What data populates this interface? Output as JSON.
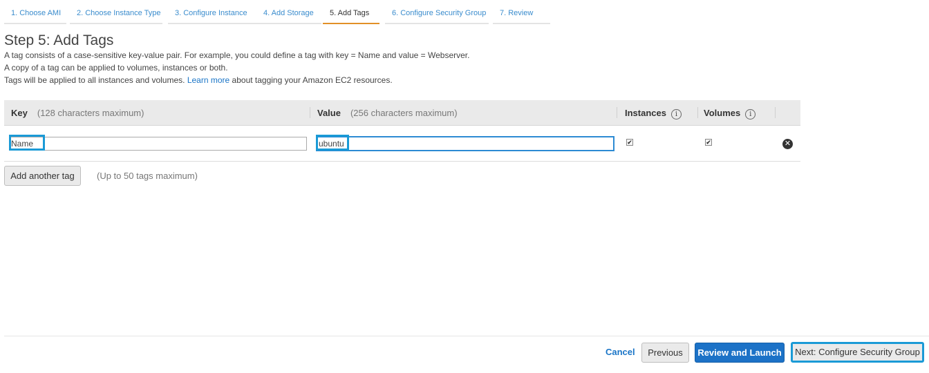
{
  "wizard": {
    "steps": [
      {
        "label": "1. Choose AMI"
      },
      {
        "label": "2. Choose Instance Type"
      },
      {
        "label": "3. Configure Instance"
      },
      {
        "label": "4. Add Storage"
      },
      {
        "label": "5. Add Tags",
        "active": true
      },
      {
        "label": "6. Configure Security Group"
      },
      {
        "label": "7. Review"
      }
    ]
  },
  "header": {
    "title": "Step 5: Add Tags",
    "line1": "A tag consists of a case-sensitive key-value pair. For example, you could define a tag with key = Name and value = Webserver.",
    "line2": "A copy of a tag can be applied to volumes, instances or both.",
    "line3_before": "Tags will be applied to all instances and volumes.",
    "learn_more": "Learn more",
    "line3_after": "about tagging your Amazon EC2 resources."
  },
  "table": {
    "columns": {
      "key": "Key",
      "key_hint": "(128 characters maximum)",
      "value": "Value",
      "value_hint": "(256 characters maximum)",
      "instances": "Instances",
      "volumes": "Volumes",
      "info_glyph": "i"
    },
    "rows": [
      {
        "key": "Name",
        "value": "ubuntu",
        "instances": true,
        "volumes": true
      }
    ],
    "checkbox_glyph": "✔",
    "remove_glyph": "✕"
  },
  "add_tag": {
    "button": "Add another tag",
    "note": "(Up to 50 tags maximum)"
  },
  "footer": {
    "cancel": "Cancel",
    "previous": "Previous",
    "review_launch": "Review and Launch",
    "next": "Next: Configure Security Group"
  },
  "colors": {
    "link": "#1a75c7",
    "active_step_underline": "#e29027",
    "primary_button": "#1c72c7",
    "highlight": "#1a9ad6"
  }
}
